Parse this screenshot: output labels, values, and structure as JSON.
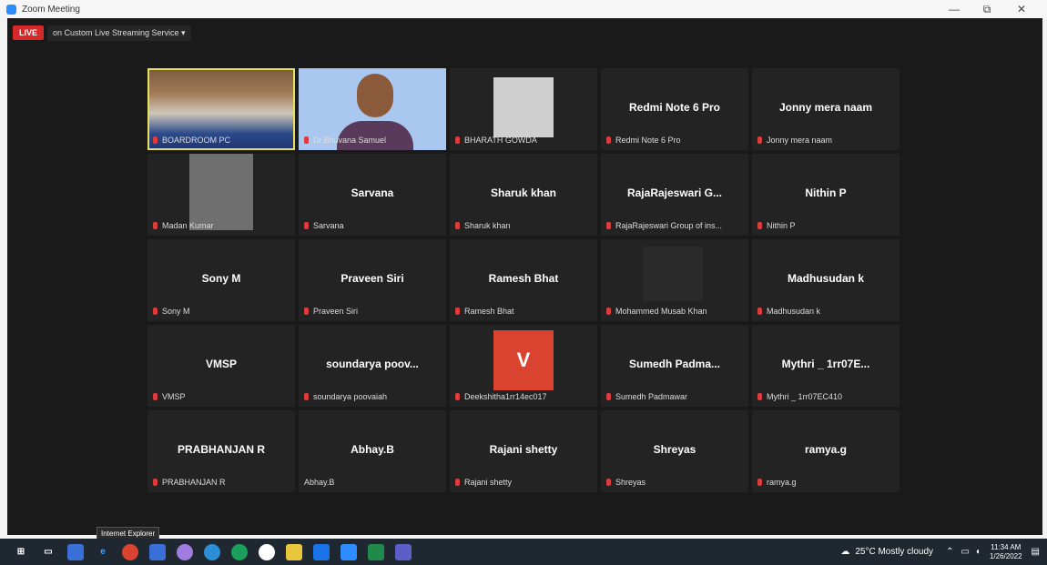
{
  "window": {
    "title": "Zoom Meeting",
    "minimize": "—",
    "restore": "⧉",
    "close": "✕"
  },
  "live": {
    "badge": "LIVE",
    "service": "on Custom Live Streaming Service ▾"
  },
  "tiles": [
    {
      "big": "",
      "small": "BOARDROOM PC"
    },
    {
      "big": "",
      "small": "Dr.Bhuvana Samuel"
    },
    {
      "big": "",
      "small": "BHARATH GOWDA"
    },
    {
      "big": "Redmi Note 6 Pro",
      "small": "Redmi Note 6 Pro"
    },
    {
      "big": "Jonny mera naam",
      "small": "Jonny mera naam"
    },
    {
      "big": "",
      "small": "Madan Kumar"
    },
    {
      "big": "Sarvana",
      "small": "Sarvana"
    },
    {
      "big": "Sharuk khan",
      "small": "Sharuk khan"
    },
    {
      "big": "RajaRajeswari G...",
      "small": "RajaRajeswari Group of ins..."
    },
    {
      "big": "Nithin P",
      "small": "Nithin P"
    },
    {
      "big": "Sony M",
      "small": "Sony M"
    },
    {
      "big": "Praveen Siri",
      "small": "Praveen Siri"
    },
    {
      "big": "Ramesh Bhat",
      "small": "Ramesh Bhat"
    },
    {
      "big": "",
      "small": "Mohammed Musab Khan"
    },
    {
      "big": "Madhusudan k",
      "small": "Madhusudan k"
    },
    {
      "big": "VMSP",
      "small": "VMSP"
    },
    {
      "big": "soundarya poov...",
      "small": "soundarya poovaiah"
    },
    {
      "big": "V",
      "small": "Deekshitha1rr14ec017"
    },
    {
      "big": "Sumedh Padma...",
      "small": "Sumedh Padmawar"
    },
    {
      "big": "Mythri _ 1rr07E...",
      "small": "Mythri _ 1rr07EC410"
    },
    {
      "big": "PRABHANJAN R",
      "small": "PRABHANJAN R"
    },
    {
      "big": "Abhay.B",
      "small": "Abhay.B"
    },
    {
      "big": "Rajani shetty",
      "small": "Rajani shetty"
    },
    {
      "big": "Shreyas",
      "small": "Shreyas"
    },
    {
      "big": "ramya.g",
      "small": "ramya.g"
    }
  ],
  "taskbar": {
    "tooltip": "Internet Explorer",
    "weather": "25°C Mostly cloudy",
    "time": "11:34 AM",
    "date": "1/26/2022"
  }
}
